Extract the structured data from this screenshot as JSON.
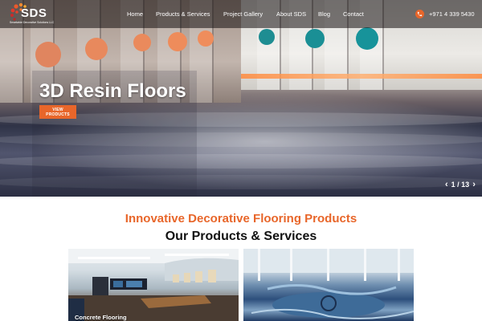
{
  "brand": {
    "logo_text": "SDS",
    "tagline": "Smartwide Decorative Solutions LLC",
    "accent_color": "#e8662a"
  },
  "nav": {
    "items": [
      {
        "label": "Home"
      },
      {
        "label": "Products & Services"
      },
      {
        "label": "Project Gallery"
      },
      {
        "label": "About SDS"
      },
      {
        "label": "Blog"
      },
      {
        "label": "Contact"
      }
    ],
    "phone": "+971 4 339 5430",
    "phone_icon": "phone-icon"
  },
  "hero": {
    "title": "3D Resin Floors",
    "button_label": "VIEW PRODUCTS",
    "slide_counter": "1 / 13",
    "prev_icon": "chevron-left-icon",
    "next_icon": "chevron-right-icon"
  },
  "section": {
    "subtitle": "Innovative Decorative Flooring Products",
    "heading": "Our Products & Services"
  },
  "cards": [
    {
      "label": "Concrete Flooring"
    },
    {
      "label": ""
    }
  ]
}
